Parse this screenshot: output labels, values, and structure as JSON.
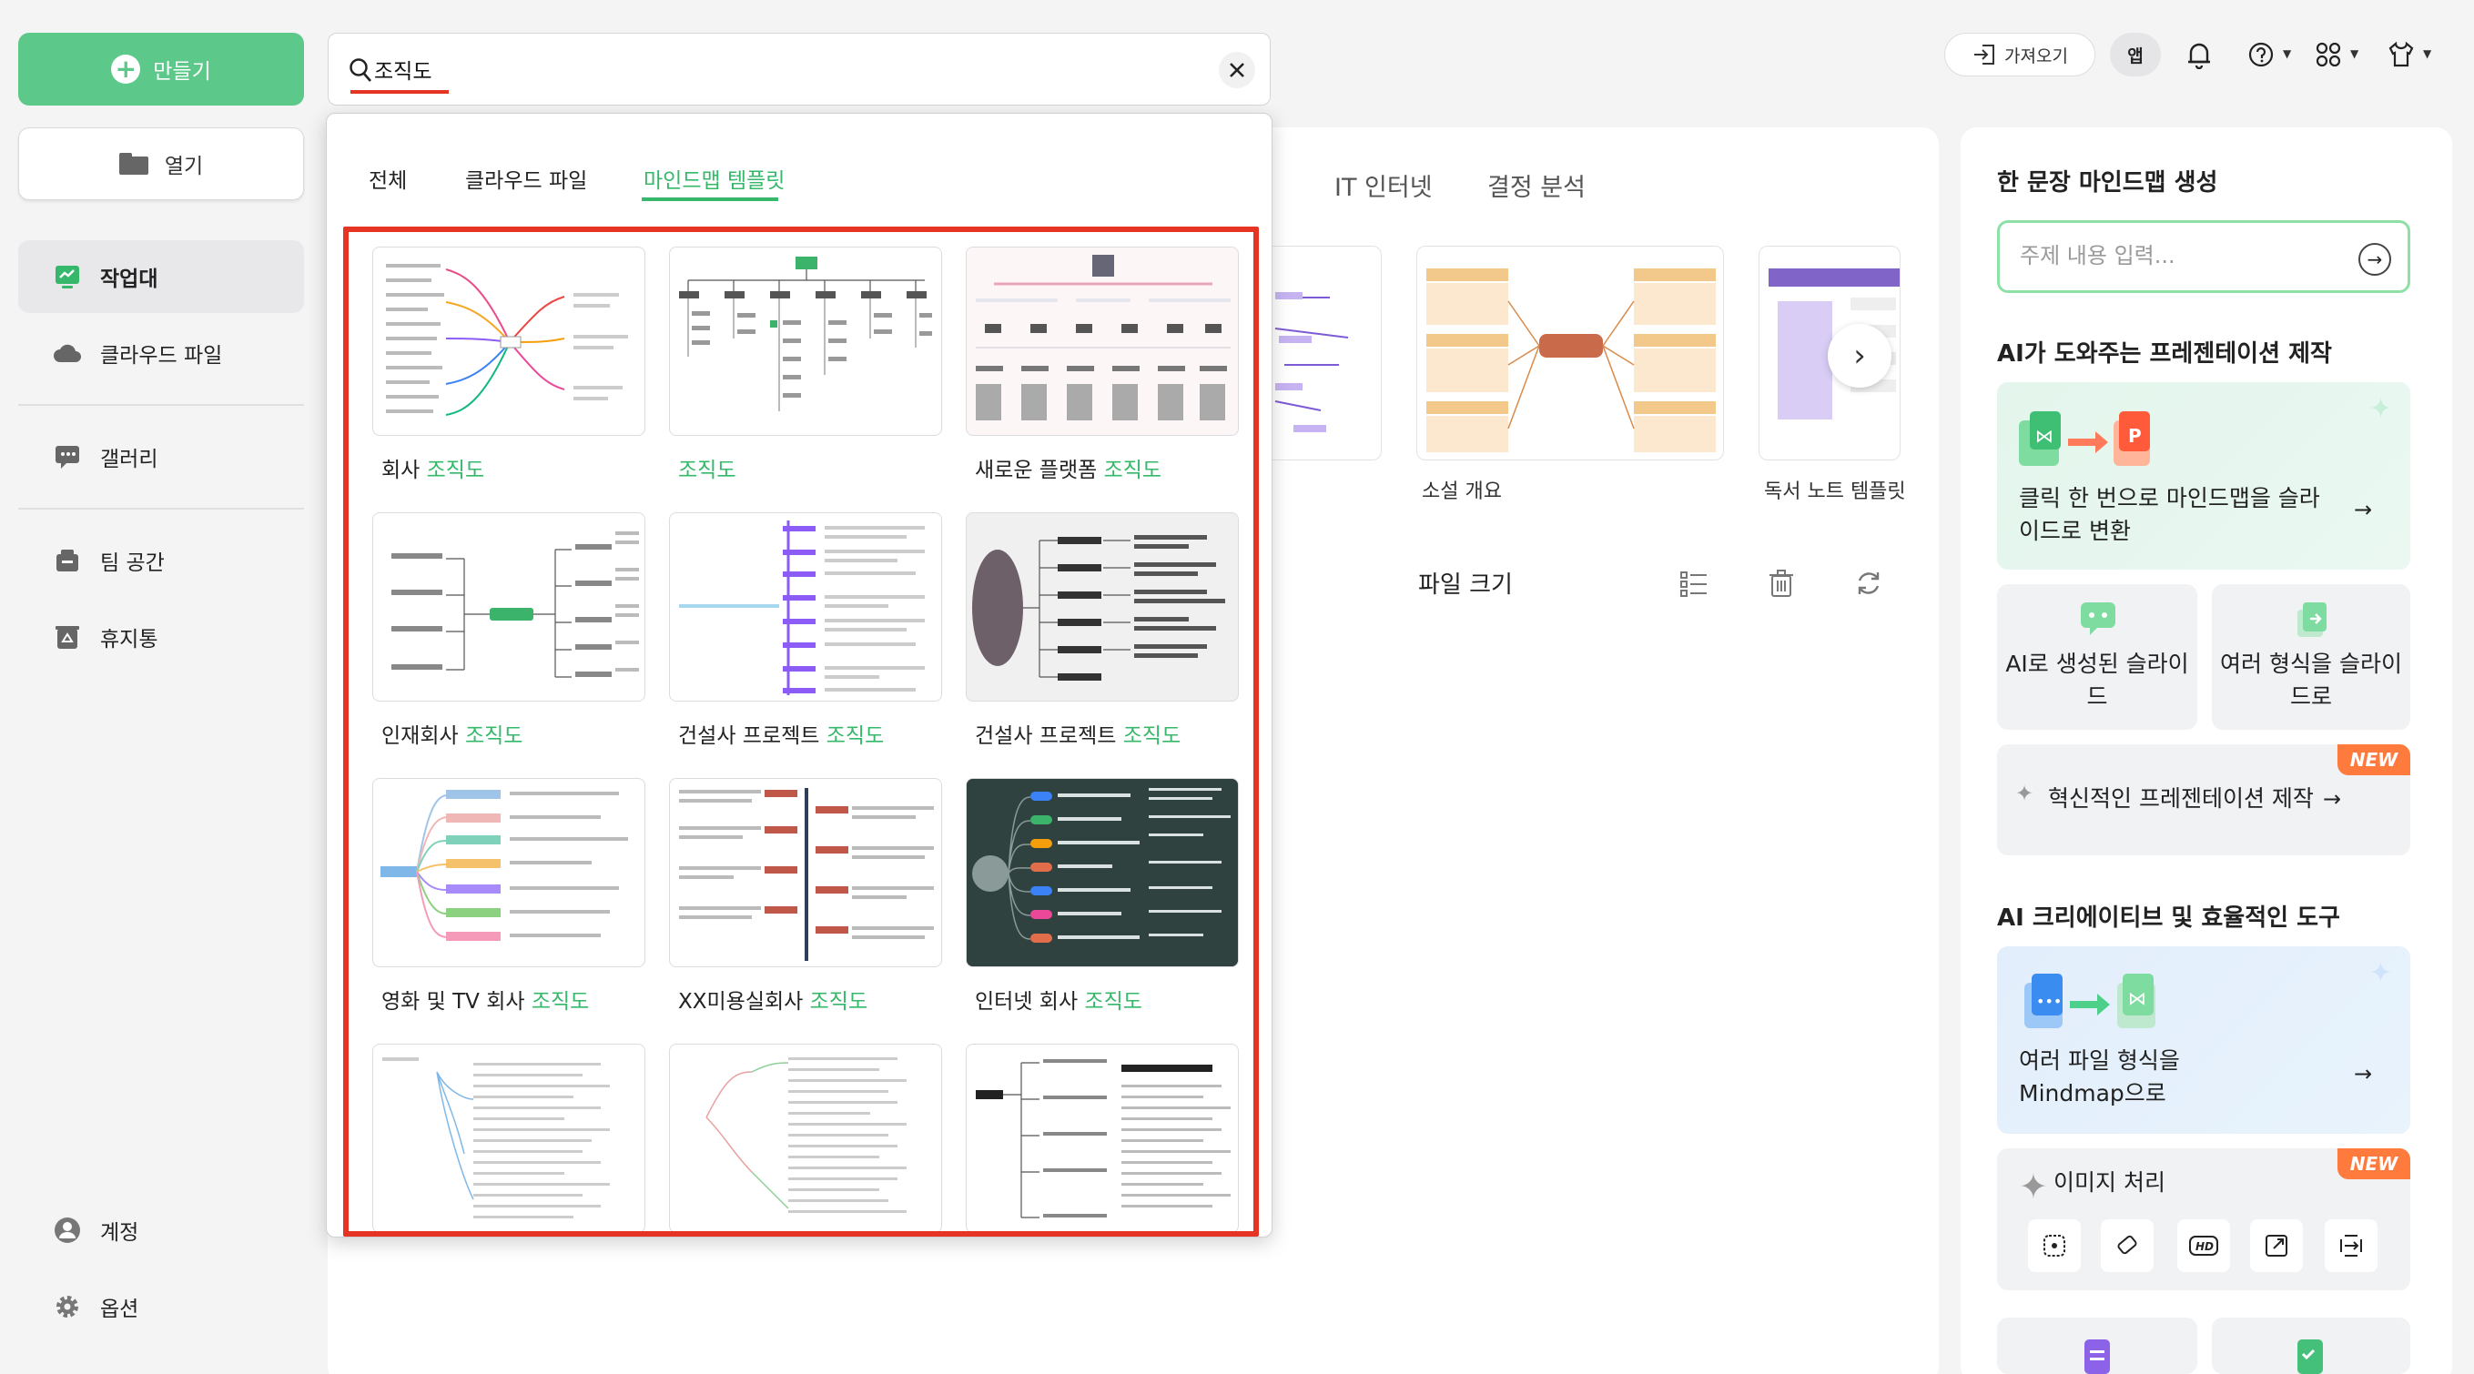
{
  "sidebar": {
    "create_label": "만들기",
    "open_label": "열기",
    "items": [
      {
        "label": "작업대"
      },
      {
        "label": "클라우드 파일"
      },
      {
        "label": "갤러리"
      },
      {
        "label": "팀 공간"
      },
      {
        "label": "휴지통"
      }
    ],
    "bottom": [
      {
        "label": "계정"
      },
      {
        "label": "옵션"
      }
    ]
  },
  "search": {
    "value": "조직도"
  },
  "toolbar": {
    "import_label": "가져오기",
    "app_label": "앱"
  },
  "main": {
    "tabs": [
      "IT 인터넷",
      "결정 분석"
    ],
    "templates": [
      "소설 개요",
      "독서 노트 템플릿"
    ],
    "file_size_label": "파일 크기"
  },
  "dropdown": {
    "tabs": [
      {
        "label": "전체"
      },
      {
        "label": "클라우드 파일"
      },
      {
        "label": "마인드맵 템플릿"
      }
    ],
    "active_tab": "마인드맵 템플릿",
    "results": [
      {
        "prefix": "회사 ",
        "highlight": "조직도"
      },
      {
        "prefix": "",
        "highlight": "조직도"
      },
      {
        "prefix": "새로운 플랫폼 ",
        "highlight": "조직도"
      },
      {
        "prefix": "인재회사 ",
        "highlight": "조직도"
      },
      {
        "prefix": "건설사 프로젝트 ",
        "highlight": "조직도"
      },
      {
        "prefix": "건설사 프로젝트 ",
        "highlight": "조직도"
      },
      {
        "prefix": "영화 및 TV 회사 ",
        "highlight": "조직도"
      },
      {
        "prefix": "XX미용실회사 ",
        "highlight": "조직도"
      },
      {
        "prefix": "인터넷 회사 ",
        "highlight": "조직도"
      }
    ]
  },
  "right_panel": {
    "one_sentence_title": "한 문장 마인드맵 생성",
    "input_placeholder": "주제 내용 입력...",
    "ai_presentation_title": "AI가 도와주는 프레젠테이션 제작",
    "convert_card_text": "클릭 한 번으로 마인드맵을 슬라이드로 변환",
    "ai_slides_text": "AI로 생성된 슬라이드",
    "formats_slides_text": "여러 형식을 슬라이드로",
    "innovative_text": "혁신적인 프레젠테이션 제작",
    "new_badge": "NEW",
    "ai_tools_title": "AI 크리에이티브 및 효율적인 도구",
    "files_to_mindmap_line1": "여러 파일 형식을",
    "files_to_mindmap_line2": "Mindmap으로",
    "image_processing": "이미지 처리"
  },
  "colors": {
    "accent_green": "#35b86a",
    "create_button": "#5cc98a",
    "highlight_red": "#e53424",
    "new_badge": "#ff7a3d"
  }
}
